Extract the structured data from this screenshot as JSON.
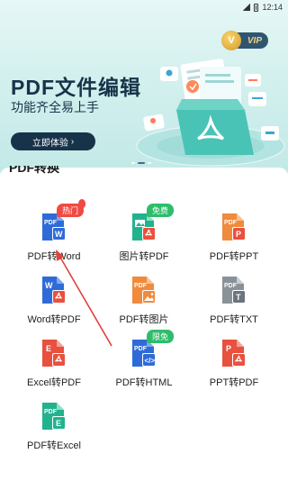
{
  "status_bar": {
    "time": "12:14"
  },
  "vip": {
    "badge_letter": "V",
    "label": "VIP"
  },
  "banner": {
    "title": "PDF文件编辑",
    "subtitle": "功能齐全易上手",
    "cta_label": "立即体验",
    "cta_arrow": "›"
  },
  "section": {
    "title": "PDF转换"
  },
  "tools": [
    {
      "label": "PDF转Word",
      "badge": "热门",
      "badge_type": "hot",
      "icon": "pdf-to-word-icon"
    },
    {
      "label": "图片转PDF",
      "badge": "免费",
      "badge_type": "free",
      "icon": "image-to-pdf-icon"
    },
    {
      "label": "PDF转PPT",
      "badge": "",
      "badge_type": "",
      "icon": "pdf-to-ppt-icon"
    },
    {
      "label": "Word转PDF",
      "badge": "",
      "badge_type": "",
      "icon": "word-to-pdf-icon"
    },
    {
      "label": "PDF转图片",
      "badge": "",
      "badge_type": "",
      "icon": "pdf-to-image-icon"
    },
    {
      "label": "PDF转TXT",
      "badge": "",
      "badge_type": "",
      "icon": "pdf-to-txt-icon"
    },
    {
      "label": "Excel转PDF",
      "badge": "",
      "badge_type": "",
      "icon": "excel-to-pdf-icon"
    },
    {
      "label": "PDF转HTML",
      "badge": "限免",
      "badge_type": "free",
      "icon": "pdf-to-html-icon"
    },
    {
      "label": "PPT转PDF",
      "badge": "",
      "badge_type": "",
      "icon": "ppt-to-pdf-icon"
    },
    {
      "label": "PDF转Excel",
      "badge": "",
      "badge_type": "",
      "icon": "pdf-to-excel-icon"
    }
  ],
  "colors": {
    "accent_dark": "#17334a",
    "hot_badge": "#f04a44",
    "free_badge": "#2fbd6b",
    "annotation_arrow": "#e0413b"
  }
}
